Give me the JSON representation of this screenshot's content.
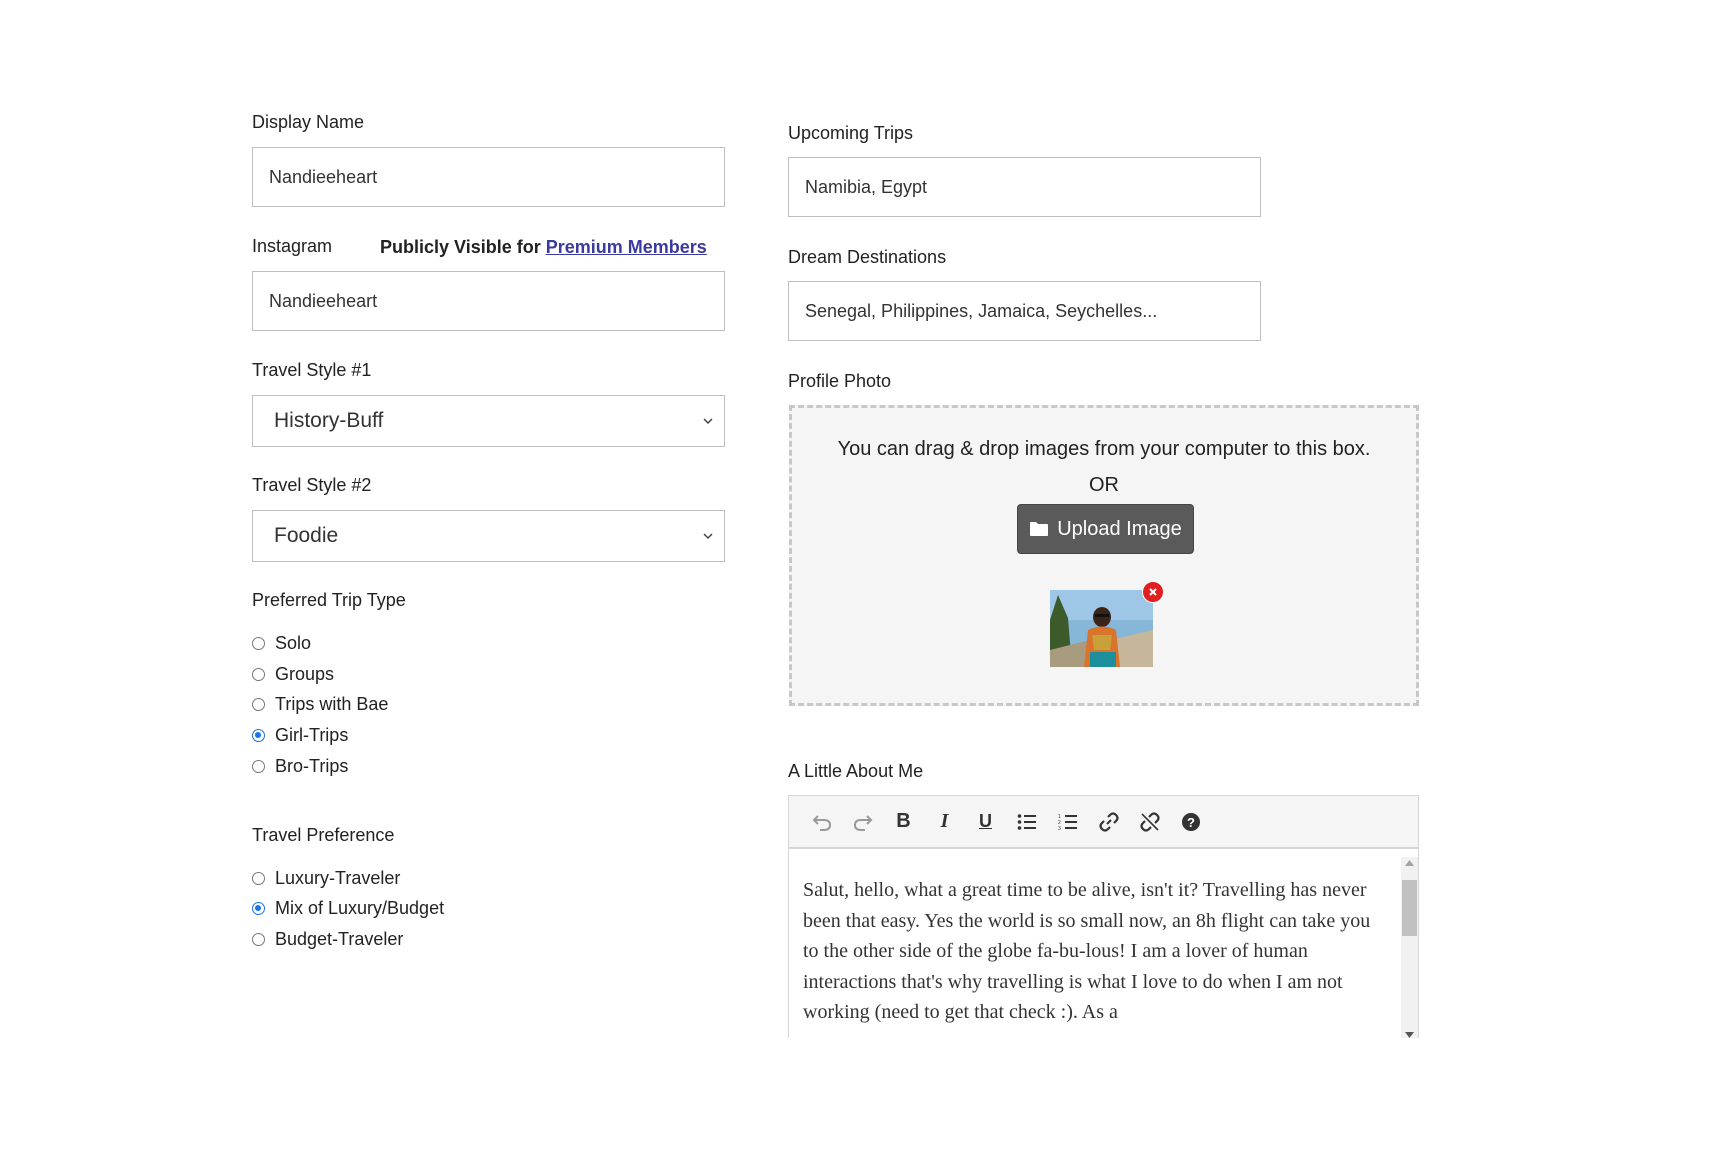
{
  "left": {
    "display_name": {
      "label": "Display Name",
      "value": "Nandieeheart"
    },
    "instagram": {
      "label": "Instagram",
      "visibility_prefix": "Publicly Visible for",
      "visibility_link": "Premium Members",
      "value": "Nandieeheart"
    },
    "travel_style_1": {
      "label": "Travel Style #1",
      "value": "History-Buff"
    },
    "travel_style_2": {
      "label": "Travel Style #2",
      "value": "Foodie"
    },
    "trip_type": {
      "label": "Preferred Trip Type",
      "options": [
        "Solo",
        "Groups",
        "Trips with Bae",
        "Girl-Trips",
        "Bro-Trips"
      ],
      "selected": "Girl-Trips"
    },
    "travel_preference": {
      "label": "Travel Preference",
      "options": [
        "Luxury-Traveler",
        "Mix of Luxury/Budget",
        "Budget-Traveler"
      ],
      "selected": "Mix of Luxury/Budget"
    }
  },
  "right": {
    "upcoming_trips": {
      "label": "Upcoming Trips",
      "value": "Namibia, Egypt"
    },
    "dream_destinations": {
      "label": "Dream Destinations",
      "value": "Senegal, Philippines, Jamaica, Seychelles..."
    },
    "profile_photo": {
      "label": "Profile Photo",
      "drop_text": "You can drag & drop images from your computer to this box.",
      "or_text": "OR",
      "upload_label": "Upload Image"
    },
    "about_me": {
      "label": "A Little About Me",
      "toolbar": [
        "undo-icon",
        "redo-icon",
        "bold-icon",
        "italic-icon",
        "underline-icon",
        "bullet-list-icon",
        "numbered-list-icon",
        "link-icon",
        "unlink-icon",
        "help-icon"
      ],
      "text": "Salut, hello,  what a great time to be alive, isn't it? Travelling has never been that easy. Yes the world is so small now, an 8h flight can take you to the other side of the globe fa-bu-lous!  I am a lover of human interactions that's why travelling is what I love to do when I am not working (need to get that check :). As a"
    }
  },
  "colors": {
    "link": "#3a3aa0",
    "radio_checked": "#1a73e8",
    "upload_button": "#5a5a5a",
    "remove_badge": "#e02020"
  }
}
